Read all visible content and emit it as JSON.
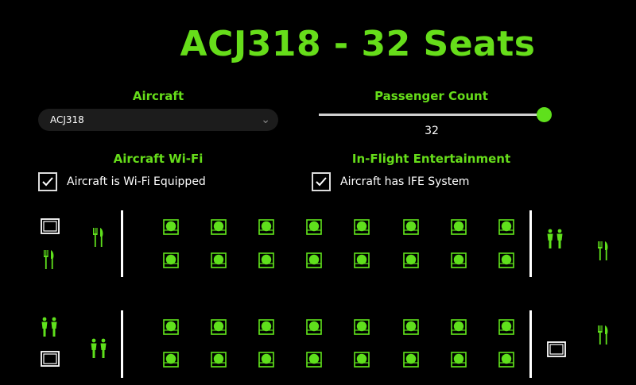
{
  "header": {
    "title": "ACJ318 - 32 Seats"
  },
  "aircraft": {
    "label": "Aircraft",
    "selected": "ACJ318"
  },
  "passenger_count": {
    "label": "Passenger Count",
    "value": "32",
    "fraction": 1.0
  },
  "wifi": {
    "label": "Aircraft Wi-Fi",
    "checkbox_label": "Aircraft is Wi-Fi Equipped",
    "checked": true
  },
  "ife": {
    "label": "In-Flight Entertainment",
    "checkbox_label": "Aircraft has IFE System",
    "checked": true
  },
  "colors": {
    "accent": "#66dd1a",
    "seat": "#5fe01c",
    "background": "#000000"
  },
  "seat_map": {
    "seat_count": 32,
    "rows_per_block": 2,
    "columns": 8,
    "blocks": 2
  },
  "icons": {
    "galley": "galley-icon",
    "dining": "utensils-icon",
    "lavatory": "restroom-icon",
    "seat": "seat-icon"
  }
}
